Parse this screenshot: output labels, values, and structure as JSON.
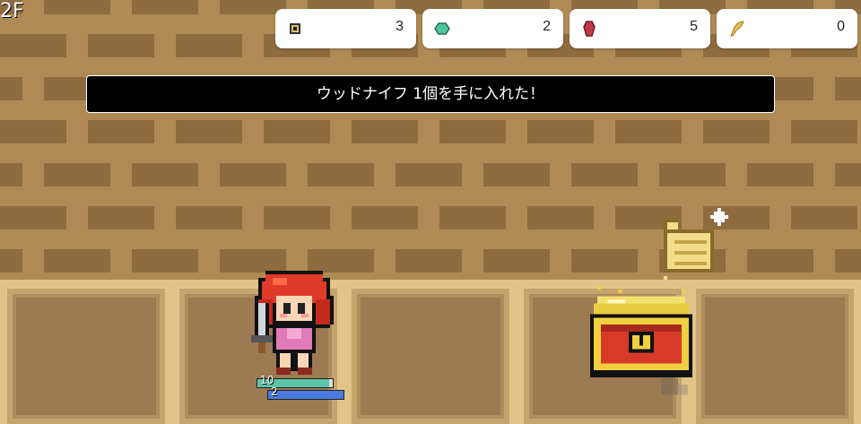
{
  "floor_indicator": "2F",
  "resources": [
    {
      "icon": "coin-icon",
      "value": "3",
      "color": "#d8c070"
    },
    {
      "icon": "green-gem-icon",
      "value": "2",
      "color": "#4cc49a"
    },
    {
      "icon": "red-gem-icon",
      "value": "5",
      "color": "#c23a4a"
    },
    {
      "icon": "feather-icon",
      "value": "0",
      "color": "#e8c050"
    }
  ],
  "message": "ウッドナイフ 1個を手に入れた！",
  "hero": {
    "hp": "10",
    "hp_fraction": 0.95,
    "hp_color": "#5cc4a8",
    "mp": "2",
    "mp_fraction": 1.0,
    "mp_color": "#4a7ae0"
  },
  "colors": {
    "wall": "#b08a54",
    "brick": "#8a6a3e",
    "floor_tile": "#9c7a52",
    "floor_border": "#e2c48a",
    "chest_red": "#d83a2a",
    "chest_gold": "#f0d040",
    "hair": "#e03a2a"
  }
}
